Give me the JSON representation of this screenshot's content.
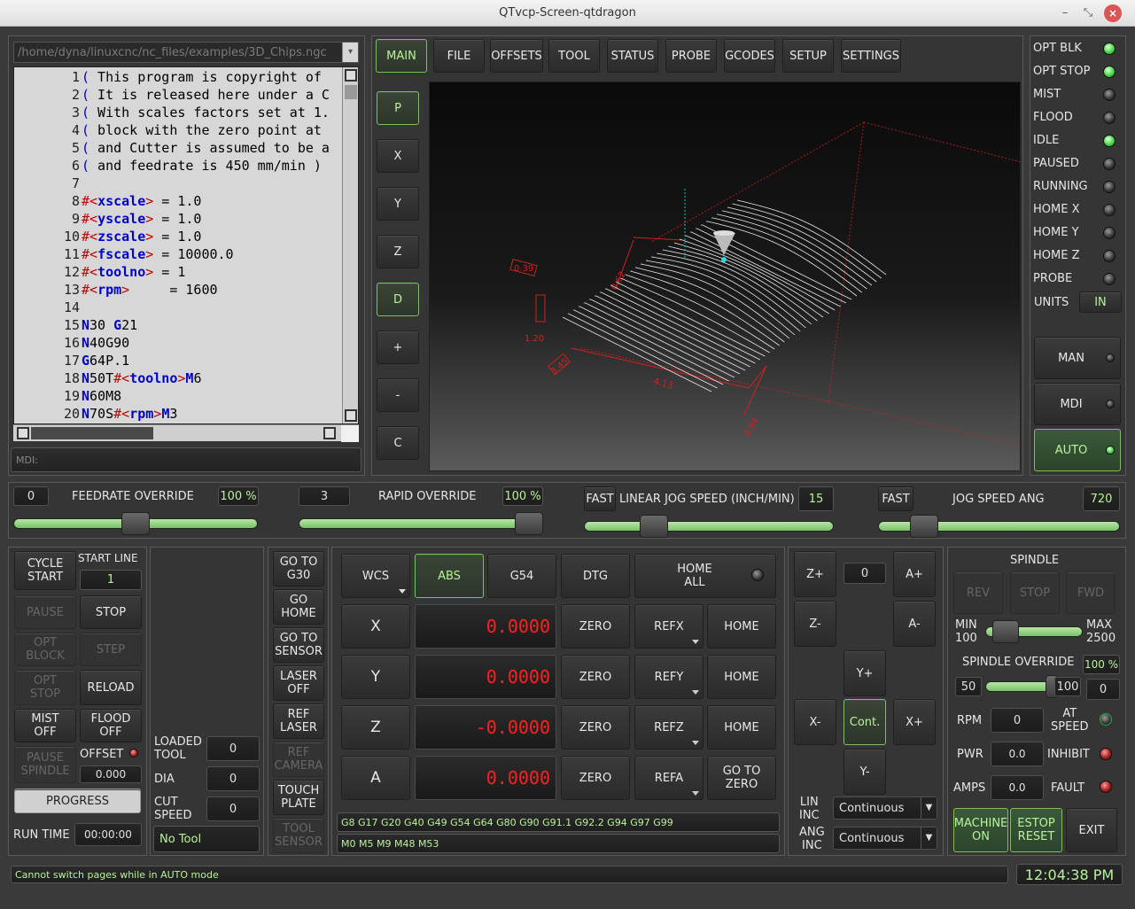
{
  "window": {
    "title": "QTvcp-Screen-qtdragon"
  },
  "file": {
    "path": "/home/dyna/linuxcnc/nc_files/examples/3D_Chips.ngc"
  },
  "code_lines": [
    {
      "n": "1",
      "text": "( This program is copyright of"
    },
    {
      "n": "2",
      "text": "( It is released here under a C"
    },
    {
      "n": "3",
      "text": "( With scales factors set at 1."
    },
    {
      "n": "4",
      "text": "( block with the zero point at"
    },
    {
      "n": "5",
      "text": "( and Cutter is assumed to be a"
    },
    {
      "n": "6",
      "text": "( and feedrate is 450 mm/min )"
    },
    {
      "n": "7",
      "text": ""
    },
    {
      "n": "8",
      "text": "#<xscale> = 1.0"
    },
    {
      "n": "9",
      "text": "#<yscale> = 1.0"
    },
    {
      "n": "10",
      "text": "#<zscale> = 1.0"
    },
    {
      "n": "11",
      "text": "#<fscale> = 10000.0"
    },
    {
      "n": "12",
      "text": "#<toolno> = 1"
    },
    {
      "n": "13",
      "text": "#<rpm>     = 1600"
    },
    {
      "n": "14",
      "text": ""
    },
    {
      "n": "15",
      "text": "N30 G21"
    },
    {
      "n": "16",
      "text": "N40G90"
    },
    {
      "n": "17",
      "text": "G64P.1"
    },
    {
      "n": "18",
      "text": "N50T#<toolno>M6"
    },
    {
      "n": "19",
      "text": "N60M8"
    },
    {
      "n": "20",
      "text": "N70S#<rpm>M3"
    }
  ],
  "mdi": {
    "placeholder": "MDI:"
  },
  "tabs": [
    "MAIN",
    "FILE",
    "OFFSETS",
    "TOOL",
    "STATUS",
    "PROBE",
    "GCODES",
    "SETUP",
    "SETTINGS"
  ],
  "view_buttons": [
    "P",
    "X",
    "Y",
    "Z",
    "D",
    "+",
    "-",
    "C"
  ],
  "preview_labels": {
    "a": "0.39",
    "b": "1.20",
    "c": "4.13",
    "d": "4.94",
    "e": "3.45",
    "f": "0.62"
  },
  "status": {
    "items": [
      {
        "label": "OPT BLK",
        "on": true
      },
      {
        "label": "OPT STOP",
        "on": true
      },
      {
        "label": "MIST",
        "on": false
      },
      {
        "label": "FLOOD",
        "on": false
      },
      {
        "label": "IDLE",
        "on": true
      },
      {
        "label": "PAUSED",
        "on": false
      },
      {
        "label": "RUNNING",
        "on": false
      },
      {
        "label": "HOME X",
        "on": false
      },
      {
        "label": "HOME Y",
        "on": false
      },
      {
        "label": "HOME Z",
        "on": false
      },
      {
        "label": "PROBE",
        "on": false
      }
    ],
    "units_label": "UNITS",
    "units_value": "IN",
    "modes": [
      "MAN",
      "MDI",
      "AUTO"
    ]
  },
  "overrides": {
    "feed": {
      "left": "0",
      "label": "FEEDRATE OVERRIDE",
      "value": "100 %",
      "level": 0.5
    },
    "rapid": {
      "left": "3",
      "label": "RAPID OVERRIDE",
      "value": "100 %",
      "level": 1.0
    },
    "linjog": {
      "fast": "FAST",
      "label": "LINEAR JOG SPEED (INCH/MIN)",
      "value": "15",
      "level": 0.25
    },
    "angjog": {
      "fast": "FAST",
      "label": "JOG SPEED ANG",
      "value": "720",
      "level": 0.15
    }
  },
  "run": {
    "cycle_start": "CYCLE\nSTART",
    "start_line": "START LINE",
    "start_line_value": "1",
    "pause": "PAUSE",
    "stop": "STOP",
    "opt_block": "OPT\nBLOCK",
    "step": "STEP",
    "opt_stop": "OPT\nSTOP",
    "reload": "RELOAD",
    "mist_off": "MIST\nOFF",
    "flood_off": "FLOOD\nOFF",
    "pause_spindle": "PAUSE\nSPINDLE",
    "offset": "OFFSET",
    "offset_value": "0.000",
    "progress": "PROGRESS",
    "run_time": "RUN TIME",
    "run_time_value": "00:00:00"
  },
  "tool": {
    "loaded": "LOADED\nTOOL",
    "loaded_value": "0",
    "dia": "DIA",
    "dia_value": "0",
    "cut_speed": "CUT\nSPEED",
    "cut_speed_value": "0",
    "tool_name": "No Tool"
  },
  "actions": [
    "GO TO\nG30",
    "GO\nHOME",
    "GO TO\nSENSOR",
    "LASER\nOFF",
    "REF\nLASER",
    "REF\nCAMERA",
    "TOUCH\nPLATE",
    "TOOL\nSENSOR"
  ],
  "dro": {
    "wcs": "WCS",
    "abs": "ABS",
    "g54": "G54",
    "dtg": "DTG",
    "home_all": "HOME\nALL",
    "axes": [
      {
        "axis": "X",
        "value": "0.0000",
        "zero": "ZERO",
        "ref": "REFX",
        "home": "HOME"
      },
      {
        "axis": "Y",
        "value": "0.0000",
        "zero": "ZERO",
        "ref": "REFY",
        "home": "HOME"
      },
      {
        "axis": "Z",
        "value": "-0.0000",
        "zero": "ZERO",
        "ref": "REFZ",
        "home": "HOME"
      },
      {
        "axis": "A",
        "value": "0.0000",
        "zero": "ZERO",
        "ref": "REFA",
        "home": "GO TO\nZERO"
      }
    ],
    "gcodes": "G8 G17 G20 G40 G49 G54 G64 G80 G90 G91.1 G92.2 G94 G97 G99",
    "mcodes": "M0 M5 M9 M48 M53"
  },
  "jog": {
    "zp": "Z+",
    "zm": "Z-",
    "ap": "A+",
    "am": "A-",
    "inc": "0",
    "yp": "Y+",
    "ym": "Y-",
    "xp": "X+",
    "xm": "X-",
    "cont": "Cont.",
    "lin_inc": "LIN\nINC",
    "ang_inc": "ANG\nINC",
    "lin_value": "Continuous",
    "ang_value": "Continuous"
  },
  "spindle": {
    "title": "SPINDLE",
    "rev": "REV",
    "stop": "STOP",
    "fwd": "FWD",
    "min": "MIN\n100",
    "max": "MAX\n2500",
    "override": "SPINDLE OVERRIDE",
    "override_value": "100 %",
    "ov_min": "50",
    "ov_max": "100",
    "ov_extra": "0",
    "rpm": "RPM",
    "rpm_value": "0",
    "at_speed": "AT\nSPEED",
    "pwr": "PWR",
    "pwr_value": "0.0",
    "inhibit": "INHIBIT",
    "amps": "AMPS",
    "amps_value": "0.0",
    "fault": "FAULT",
    "machine_on": "MACHINE\nON",
    "estop_reset": "ESTOP\nRESET",
    "exit": "EXIT",
    "speed_level": 0.1,
    "override_level": 0.9
  },
  "statusbar": {
    "message": "Cannot switch pages while in AUTO mode",
    "clock": "12:04:38 PM"
  }
}
